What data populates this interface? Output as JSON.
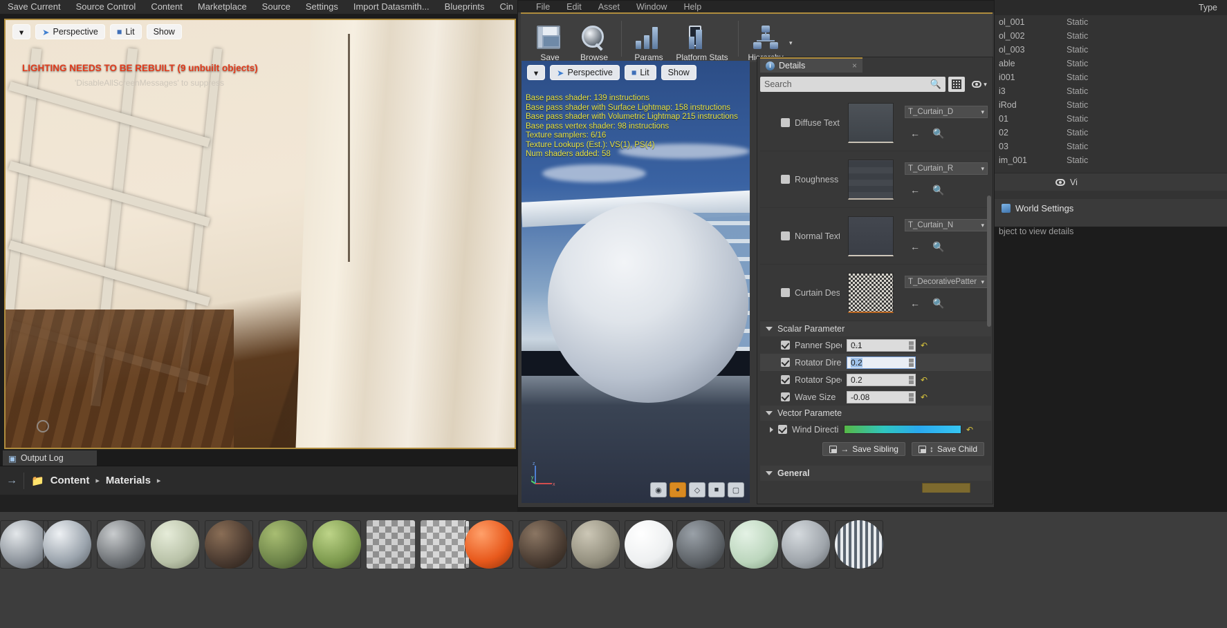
{
  "main_menu": {
    "items": [
      "Save Current",
      "Source Control",
      "Content",
      "Marketplace",
      "Source",
      "Settings",
      "Import Datasmith...",
      "Blueprints",
      "Cin"
    ]
  },
  "level_viewport": {
    "dropdown_icon": "chevron-down-icon",
    "view_mode": "Perspective",
    "lighting_mode": "Lit",
    "show_menu": "Show",
    "warning": "LIGHTING NEEDS TO BE REBUILT (9 unbuilt objects)",
    "warning_sub": "'DisableAllScreenMessages' to suppress"
  },
  "output_log": {
    "tab_label": "Output Log",
    "close_icon": "close-icon"
  },
  "content_browser": {
    "back_icon": "arrow-right-icon",
    "folder_icon": "folder-icon",
    "crumbs": [
      "Content",
      "Materials"
    ],
    "chevron": "▸"
  },
  "material_editor": {
    "menu": [
      "File",
      "Edit",
      "Asset",
      "Window",
      "Help"
    ],
    "toolbar": [
      {
        "label": "Save",
        "icon": "save-floppy-icon"
      },
      {
        "label": "Browse",
        "icon": "magnifier-icon"
      },
      {
        "label": "Params",
        "icon": "params-bars-icon"
      },
      {
        "label": "Platform Stats",
        "icon": "platform-stats-icon"
      },
      {
        "label": "Hierarchy",
        "icon": "hierarchy-icon"
      }
    ],
    "hierarchy_caret": "▾",
    "preview": {
      "dropdown_icon": "chevron-down-icon",
      "view_mode": "Perspective",
      "lighting_mode": "Lit",
      "show_menu": "Show",
      "stats": [
        "Base pass shader: 139 instructions",
        "Base pass shader with Surface Lightmap: 158 instructions",
        "Base pass shader with Volumetric Lightmap 215 instructions",
        "Base pass vertex shader: 98 instructions",
        "Texture samplers: 6/16",
        "Texture Lookups (Est.): VS(1), PS(4)",
        "Num shaders added: 58"
      ],
      "axis_labels": [
        "z",
        "y",
        "x"
      ],
      "shape_buttons": [
        {
          "icon": "cylinder-shape-icon",
          "active": false
        },
        {
          "icon": "sphere-shape-icon",
          "active": true
        },
        {
          "icon": "plane-shape-icon",
          "active": false
        },
        {
          "icon": "cube-shape-icon",
          "active": false
        },
        {
          "icon": "custom-mesh-icon",
          "active": false
        }
      ]
    }
  },
  "details": {
    "tab_label": "Details",
    "tab_icon": "info-icon",
    "close_icon": "close-icon",
    "search": {
      "placeholder": "Search",
      "value": "",
      "icon": "search-icon"
    },
    "grid_button_icon": "grid-view-icon",
    "eye_button_icon": "eye-icon",
    "eye_caret": "▾",
    "texture_params": [
      {
        "label": "Diffuse Text",
        "checked": false,
        "texture": "T_Curtain_D",
        "thumb": "#4a4f55",
        "back_icon": "arrow-left-icon",
        "browse_icon": "magnifier-icon"
      },
      {
        "label": "Roughness T",
        "checked": false,
        "texture": "T_Curtain_R",
        "thumb": "#3f4349",
        "back_icon": "arrow-left-icon",
        "browse_icon": "magnifier-icon"
      },
      {
        "label": "Normal Text",
        "checked": false,
        "texture": "T_Curtain_N",
        "thumb": "#41454d",
        "back_icon": "arrow-left-icon",
        "browse_icon": "magnifier-icon"
      },
      {
        "label": "Curtain Desi",
        "checked": false,
        "texture": "T_DecorativePatter",
        "thumb": "#8f8d87",
        "back_icon": "arrow-left-icon",
        "browse_icon": "magnifier-icon"
      }
    ],
    "scalar_section": {
      "title": "Scalar Parameter",
      "expanded": true
    },
    "scalar_params": [
      {
        "label": "Panner Spee",
        "value": "0.1",
        "checked": true,
        "editing": false,
        "reset_icon": "reset-arrow-icon"
      },
      {
        "label": "Rotator Direc",
        "value": "0.2",
        "checked": true,
        "editing": true,
        "reset_icon": "reset-arrow-icon"
      },
      {
        "label": "Rotator Spee",
        "value": "0.2",
        "checked": true,
        "editing": false,
        "reset_icon": "reset-arrow-icon"
      },
      {
        "label": "Wave Size",
        "value": "-0.08",
        "checked": true,
        "editing": false,
        "reset_icon": "reset-arrow-icon"
      }
    ],
    "vector_section": {
      "title": "Vector Paramete",
      "expanded": true
    },
    "vector_params": [
      {
        "label": "Wind Directi",
        "checked": true,
        "expand_icon": "chevron-right-icon",
        "gradient": [
          "#56b846",
          "#2fc6c0",
          "#2aa9ef",
          "#36c6f2"
        ],
        "reset_icon": "reset-arrow-icon"
      }
    ],
    "save_sibling": {
      "label": "Save Sibling",
      "icon": "save-floppy-icon",
      "arrow": "→"
    },
    "save_child": {
      "label": "Save Child",
      "icon": "save-floppy-icon",
      "arrow": "↕"
    },
    "general_section": {
      "title": "General",
      "expanded": true
    }
  },
  "outliner": {
    "type_header": "Type",
    "rows": [
      {
        "name": "ol_001",
        "type": "Static"
      },
      {
        "name": "ol_002",
        "type": "Static"
      },
      {
        "name": "ol_003",
        "type": "Static"
      },
      {
        "name": "able",
        "type": "Static"
      },
      {
        "name": "i001",
        "type": "Static"
      },
      {
        "name": "i3",
        "type": "Static"
      },
      {
        "name": "iRod",
        "type": "Static"
      },
      {
        "name": "01",
        "type": "Static"
      },
      {
        "name": "02",
        "type": "Static"
      },
      {
        "name": "03",
        "type": "Static"
      },
      {
        "name": "im_001",
        "type": "Static"
      }
    ],
    "view_options": {
      "label": "Vi",
      "icon": "eye-icon"
    }
  },
  "world_settings": {
    "tab_label": "World Settings",
    "icon": "cube-icon",
    "hint": "bject to view details"
  },
  "asset_thumbnails": [
    {
      "color": "#8d949c",
      "kind": "sphere"
    },
    {
      "color": "#9aa3ac",
      "kind": "sphere"
    },
    {
      "color": "#6e7276",
      "kind": "sphere"
    },
    {
      "color": "#b9c2a8",
      "kind": "sphere"
    },
    {
      "color": "#4a3a30",
      "kind": "sphere"
    },
    {
      "color": "#6d8449",
      "kind": "sphere"
    },
    {
      "color": "#7d9a4e",
      "kind": "sphere"
    },
    {
      "color": "#cfcfcf",
      "kind": "checker"
    },
    {
      "color": "#cfcfcf",
      "kind": "checker"
    },
    {
      "color": "#e8591c",
      "kind": "sphere"
    },
    {
      "color": "#4a3c32",
      "kind": "sphere"
    },
    {
      "color": "#94907f",
      "kind": "sphere"
    },
    {
      "color": "#eef0f1",
      "kind": "sphere"
    },
    {
      "color": "#5e6368",
      "kind": "sphere"
    },
    {
      "color": "#bcd6bd",
      "kind": "sphere"
    },
    {
      "color": "#9fa5ab",
      "kind": "sphere"
    },
    {
      "color": "#6f7a86",
      "kind": "striped"
    }
  ]
}
